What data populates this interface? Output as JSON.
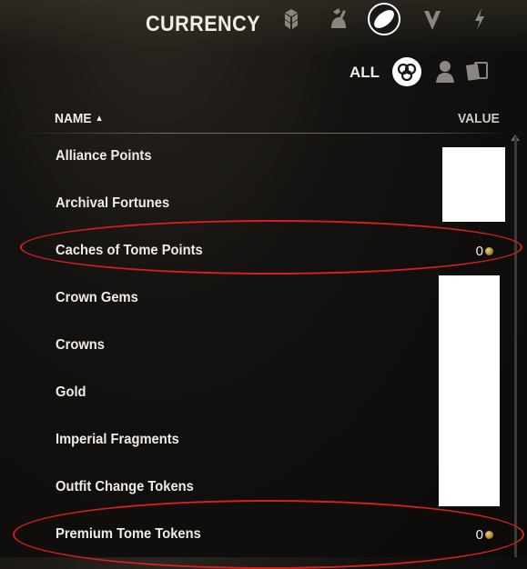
{
  "header": {
    "title": "CURRENCY"
  },
  "categories": [
    {
      "icon": "treasure-blocks-icon"
    },
    {
      "icon": "crafting-bag-icon"
    },
    {
      "icon": "currency-coin-icon",
      "active": true
    },
    {
      "icon": "shield-emblem-icon"
    },
    {
      "icon": "lightning-icon"
    }
  ],
  "filters": {
    "all_label": "ALL",
    "icons": [
      "account-wide-icon",
      "character-icon",
      "cards-icon"
    ]
  },
  "table": {
    "name_header": "NAME",
    "sort_indicator": "▲",
    "value_header": "VALUE",
    "rows": [
      {
        "name": "Alliance Points",
        "value": ""
      },
      {
        "name": "Archival Fortunes",
        "value": ""
      },
      {
        "name": "Caches of Tome Points",
        "value": "0"
      },
      {
        "name": "Crown Gems",
        "value": ""
      },
      {
        "name": "Crowns",
        "value": ""
      },
      {
        "name": "Gold",
        "value": ""
      },
      {
        "name": "Imperial Fragments",
        "value": ""
      },
      {
        "name": "Outfit Change Tokens",
        "value": ""
      },
      {
        "name": "Premium Tome Tokens",
        "value": "0"
      }
    ]
  },
  "annotations": {
    "highlight_color": "#d81f1f"
  }
}
